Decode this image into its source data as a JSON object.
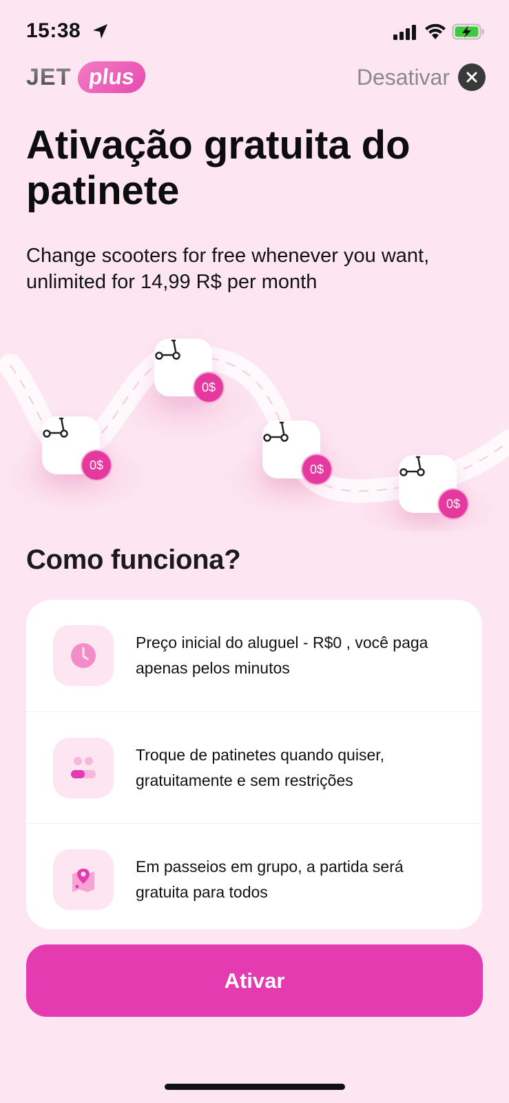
{
  "status_bar": {
    "time": "15:38",
    "icons": [
      "location-arrow-icon",
      "signal-icon",
      "wifi-icon",
      "battery-charging-icon"
    ],
    "battery_color": "#3dcb3d"
  },
  "header": {
    "brand_name": "JET",
    "brand_badge": "plus",
    "deactivate_label": "Desativar"
  },
  "title": "Ativação gratuita do patinete",
  "subtitle": "Change scooters for free whenever you want, unlimited for 14,99 R$ per month",
  "route": {
    "stops": [
      {
        "icon": "scooter-icon",
        "price": "0$"
      },
      {
        "icon": "scooter-icon",
        "price": "0$"
      },
      {
        "icon": "scooter-icon",
        "price": "0$"
      },
      {
        "icon": "scooter-icon",
        "price": "0$"
      }
    ]
  },
  "how_it_works": {
    "title": "Como funciona?",
    "items": [
      {
        "icon": "clock-icon",
        "text": "Preço inicial do aluguel - R$0 , você paga apenas pelos minutos"
      },
      {
        "icon": "group-icon",
        "text": "Troque de patinetes quando quiser, gratuitamente e sem restrições"
      },
      {
        "icon": "map-pin-icon",
        "text": "Em passeios em grupo, a partida será gratuita para todos"
      }
    ]
  },
  "activate_button": {
    "label": "Ativar"
  },
  "colors": {
    "background": "#fde6f1",
    "accent": "#e43cb0",
    "badge": "#e5399f",
    "icon_tint": "#f48cc9"
  }
}
